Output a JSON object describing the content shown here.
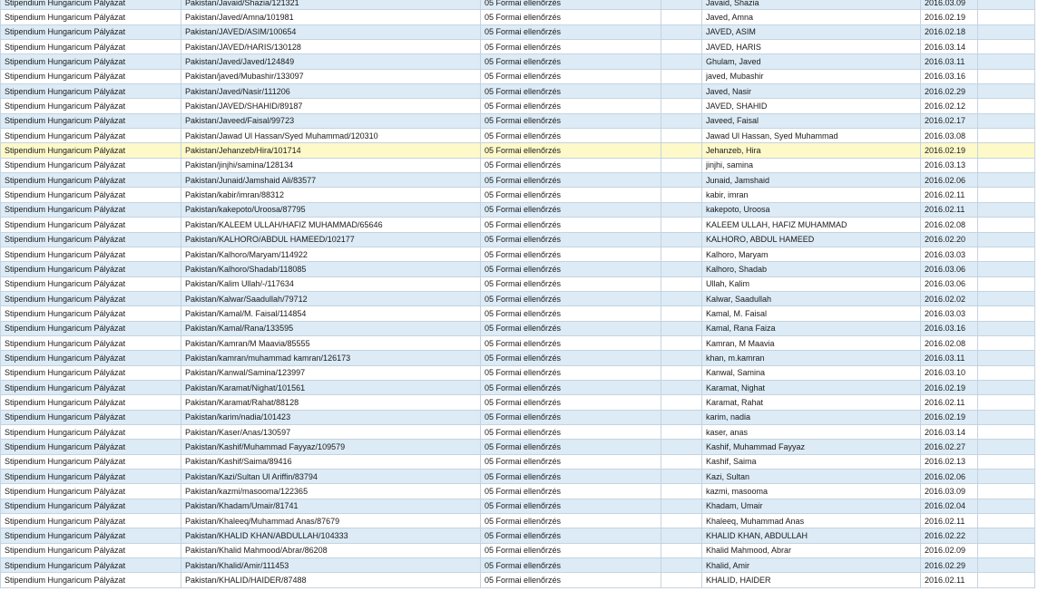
{
  "table": {
    "selected_index": 10,
    "rows": [
      {
        "program": "Stipendium Hungaricum Pályázat",
        "code": "Pakistan/Javaid/Shazia/121321",
        "status": "05 Formai ellenőrzés",
        "name": "Javaid, Shazia",
        "date": "2016.03.09"
      },
      {
        "program": "Stipendium Hungaricum Pályázat",
        "code": "Pakistan/Javed/Amna/101981",
        "status": "05 Formai ellenőrzés",
        "name": "Javed, Amna",
        "date": "2016.02.19"
      },
      {
        "program": "Stipendium Hungaricum Pályázat",
        "code": "Pakistan/JAVED/ASIM/100654",
        "status": "05 Formai ellenőrzés",
        "name": "JAVED, ASIM",
        "date": "2016.02.18"
      },
      {
        "program": "Stipendium Hungaricum Pályázat",
        "code": "Pakistan/JAVED/HARIS/130128",
        "status": "05 Formai ellenőrzés",
        "name": "JAVED, HARIS",
        "date": "2016.03.14"
      },
      {
        "program": "Stipendium Hungaricum Pályázat",
        "code": "Pakistan/Javed/Javed/124849",
        "status": "05 Formai ellenőrzés",
        "name": "Ghulam, Javed",
        "date": "2016.03.11"
      },
      {
        "program": "Stipendium Hungaricum Pályázat",
        "code": "Pakistan/javed/Mubashir/133097",
        "status": "05 Formai ellenőrzés",
        "name": "javed, Mubashir",
        "date": "2016.03.16"
      },
      {
        "program": "Stipendium Hungaricum Pályázat",
        "code": "Pakistan/Javed/Nasir/111206",
        "status": "05 Formai ellenőrzés",
        "name": "Javed, Nasir",
        "date": "2016.02.29"
      },
      {
        "program": "Stipendium Hungaricum Pályázat",
        "code": "Pakistan/JAVED/SHAHID/89187",
        "status": "05 Formai ellenőrzés",
        "name": "JAVED, SHAHID",
        "date": "2016.02.12"
      },
      {
        "program": "Stipendium Hungaricum Pályázat",
        "code": "Pakistan/Javeed/Faisal/99723",
        "status": "05 Formai ellenőrzés",
        "name": "Javeed, Faisal",
        "date": "2016.02.17"
      },
      {
        "program": "Stipendium Hungaricum Pályázat",
        "code": "Pakistan/Jawad Ul Hassan/Syed Muhammad/120310",
        "status": "05 Formai ellenőrzés",
        "name": "Jawad Ul Hassan, Syed Muhammad",
        "date": "2016.03.08"
      },
      {
        "program": "Stipendium Hungaricum Pályázat",
        "code": "Pakistan/Jehanzeb/Hira/101714",
        "status": "05 Formai ellenőrzés",
        "name": "Jehanzeb, Hira",
        "date": "2016.02.19"
      },
      {
        "program": "Stipendium Hungaricum Pályázat",
        "code": "Pakistan/jinjhi/samina/128134",
        "status": "05 Formai ellenőrzés",
        "name": "jinjhi, samina",
        "date": "2016.03.13"
      },
      {
        "program": "Stipendium Hungaricum Pályázat",
        "code": "Pakistan/Junaid/Jamshaid Ali/83577",
        "status": "05 Formai ellenőrzés",
        "name": "Junaid, Jamshaid",
        "date": "2016.02.06"
      },
      {
        "program": "Stipendium Hungaricum Pályázat",
        "code": "Pakistan/kabir/imran/88312",
        "status": "05 Formai ellenőrzés",
        "name": "kabir, imran",
        "date": "2016.02.11"
      },
      {
        "program": "Stipendium Hungaricum Pályázat",
        "code": "Pakistan/kakepoto/Uroosa/87795",
        "status": "05 Formai ellenőrzés",
        "name": "kakepoto, Uroosa",
        "date": "2016.02.11"
      },
      {
        "program": "Stipendium Hungaricum Pályázat",
        "code": "Pakistan/KALEEM ULLAH/HAFIZ MUHAMMAD/65646",
        "status": "05 Formai ellenőrzés",
        "name": "KALEEM ULLAH, HAFIZ MUHAMMAD",
        "date": "2016.02.08"
      },
      {
        "program": "Stipendium Hungaricum Pályázat",
        "code": "Pakistan/KALHORO/ABDUL HAMEED/102177",
        "status": "05 Formai ellenőrzés",
        "name": "KALHORO, ABDUL HAMEED",
        "date": "2016.02.20"
      },
      {
        "program": "Stipendium Hungaricum Pályázat",
        "code": "Pakistan/Kalhoro/Maryam/114922",
        "status": "05 Formai ellenőrzés",
        "name": "Kalhoro, Maryam",
        "date": "2016.03.03"
      },
      {
        "program": "Stipendium Hungaricum Pályázat",
        "code": "Pakistan/Kalhoro/Shadab/118085",
        "status": "05 Formai ellenőrzés",
        "name": "Kalhoro, Shadab",
        "date": "2016.03.06"
      },
      {
        "program": "Stipendium Hungaricum Pályázat",
        "code": "Pakistan/Kalim Ullah/-/117634",
        "status": "05 Formai ellenőrzés",
        "name": "Ullah, Kalim",
        "date": "2016.03.06"
      },
      {
        "program": "Stipendium Hungaricum Pályázat",
        "code": "Pakistan/Kalwar/Saadullah/79712",
        "status": "05 Formai ellenőrzés",
        "name": "Kalwar, Saadullah",
        "date": "2016.02.02"
      },
      {
        "program": "Stipendium Hungaricum Pályázat",
        "code": "Pakistan/Kamal/M. Faisal/114854",
        "status": "05 Formai ellenőrzés",
        "name": "Kamal, M. Faisal",
        "date": "2016.03.03"
      },
      {
        "program": "Stipendium Hungaricum Pályázat",
        "code": "Pakistan/Kamal/Rana/133595",
        "status": "05 Formai ellenőrzés",
        "name": "Kamal, Rana Faiza",
        "date": "2016.03.16"
      },
      {
        "program": "Stipendium Hungaricum Pályázat",
        "code": "Pakistan/Kamran/M Maavia/85555",
        "status": "05 Formai ellenőrzés",
        "name": "Kamran, M Maavia",
        "date": "2016.02.08"
      },
      {
        "program": "Stipendium Hungaricum Pályázat",
        "code": "Pakistan/kamran/muhammad kamran/126173",
        "status": "05 Formai ellenőrzés",
        "name": "khan, m.kamran",
        "date": "2016.03.11"
      },
      {
        "program": "Stipendium Hungaricum Pályázat",
        "code": "Pakistan/Kanwal/Samina/123997",
        "status": "05 Formai ellenőrzés",
        "name": "Kanwal, Samina",
        "date": "2016.03.10"
      },
      {
        "program": "Stipendium Hungaricum Pályázat",
        "code": "Pakistan/Karamat/Nighat/101561",
        "status": "05 Formai ellenőrzés",
        "name": "Karamat, Nighat",
        "date": "2016.02.19"
      },
      {
        "program": "Stipendium Hungaricum Pályázat",
        "code": "Pakistan/Karamat/Rahat/88128",
        "status": "05 Formai ellenőrzés",
        "name": "Karamat, Rahat",
        "date": "2016.02.11"
      },
      {
        "program": "Stipendium Hungaricum Pályázat",
        "code": "Pakistan/karim/nadia/101423",
        "status": "05 Formai ellenőrzés",
        "name": "karim, nadia",
        "date": "2016.02.19"
      },
      {
        "program": "Stipendium Hungaricum Pályázat",
        "code": "Pakistan/Kaser/Anas/130597",
        "status": "05 Formai ellenőrzés",
        "name": "kaser, anas",
        "date": "2016.03.14"
      },
      {
        "program": "Stipendium Hungaricum Pályázat",
        "code": "Pakistan/Kashif/Muhammad Fayyaz/109579",
        "status": "05 Formai ellenőrzés",
        "name": "Kashif, Muhammad Fayyaz",
        "date": "2016.02.27"
      },
      {
        "program": "Stipendium Hungaricum Pályázat",
        "code": "Pakistan/Kashif/Saima/89416",
        "status": "05 Formai ellenőrzés",
        "name": "Kashif, Saima",
        "date": "2016.02.13"
      },
      {
        "program": "Stipendium Hungaricum Pályázat",
        "code": "Pakistan/Kazi/Sultan Ul Ariffin/83794",
        "status": "05 Formai ellenőrzés",
        "name": "Kazi, Sultan",
        "date": "2016.02.06"
      },
      {
        "program": "Stipendium Hungaricum Pályázat",
        "code": "Pakistan/kazmi/masooma/122365",
        "status": "05 Formai ellenőrzés",
        "name": "kazmi, masooma",
        "date": "2016.03.09"
      },
      {
        "program": "Stipendium Hungaricum Pályázat",
        "code": "Pakistan/Khadam/Umair/81741",
        "status": "05 Formai ellenőrzés",
        "name": "Khadam, Umair",
        "date": "2016.02.04"
      },
      {
        "program": "Stipendium Hungaricum Pályázat",
        "code": "Pakistan/Khaleeq/Muhammad Anas/87679",
        "status": "05 Formai ellenőrzés",
        "name": "Khaleeq, Muhammad Anas",
        "date": "2016.02.11"
      },
      {
        "program": "Stipendium Hungaricum Pályázat",
        "code": "Pakistan/KHALID KHAN/ABDULLAH/104333",
        "status": "05 Formai ellenőrzés",
        "name": "KHALID KHAN, ABDULLAH",
        "date": "2016.02.22"
      },
      {
        "program": "Stipendium Hungaricum Pályázat",
        "code": "Pakistan/Khalid Mahmood/Abrar/86208",
        "status": "05 Formai ellenőrzés",
        "name": "Khalid Mahmood, Abrar",
        "date": "2016.02.09"
      },
      {
        "program": "Stipendium Hungaricum Pályázat",
        "code": "Pakistan/Khalid/Amir/111453",
        "status": "05 Formai ellenőrzés",
        "name": "Khalid, Amir",
        "date": "2016.02.29"
      },
      {
        "program": "Stipendium Hungaricum Pályázat",
        "code": "Pakistan/KHALID/HAIDER/87488",
        "status": "05 Formai ellenőrzés",
        "name": "KHALID, HAIDER",
        "date": "2016.02.11"
      }
    ]
  },
  "colors": {
    "row_alt": "#dcebf5",
    "row_plain": "#ffffff",
    "row_selected": "#fdf9c8",
    "grid_line": "#c6d3df"
  }
}
